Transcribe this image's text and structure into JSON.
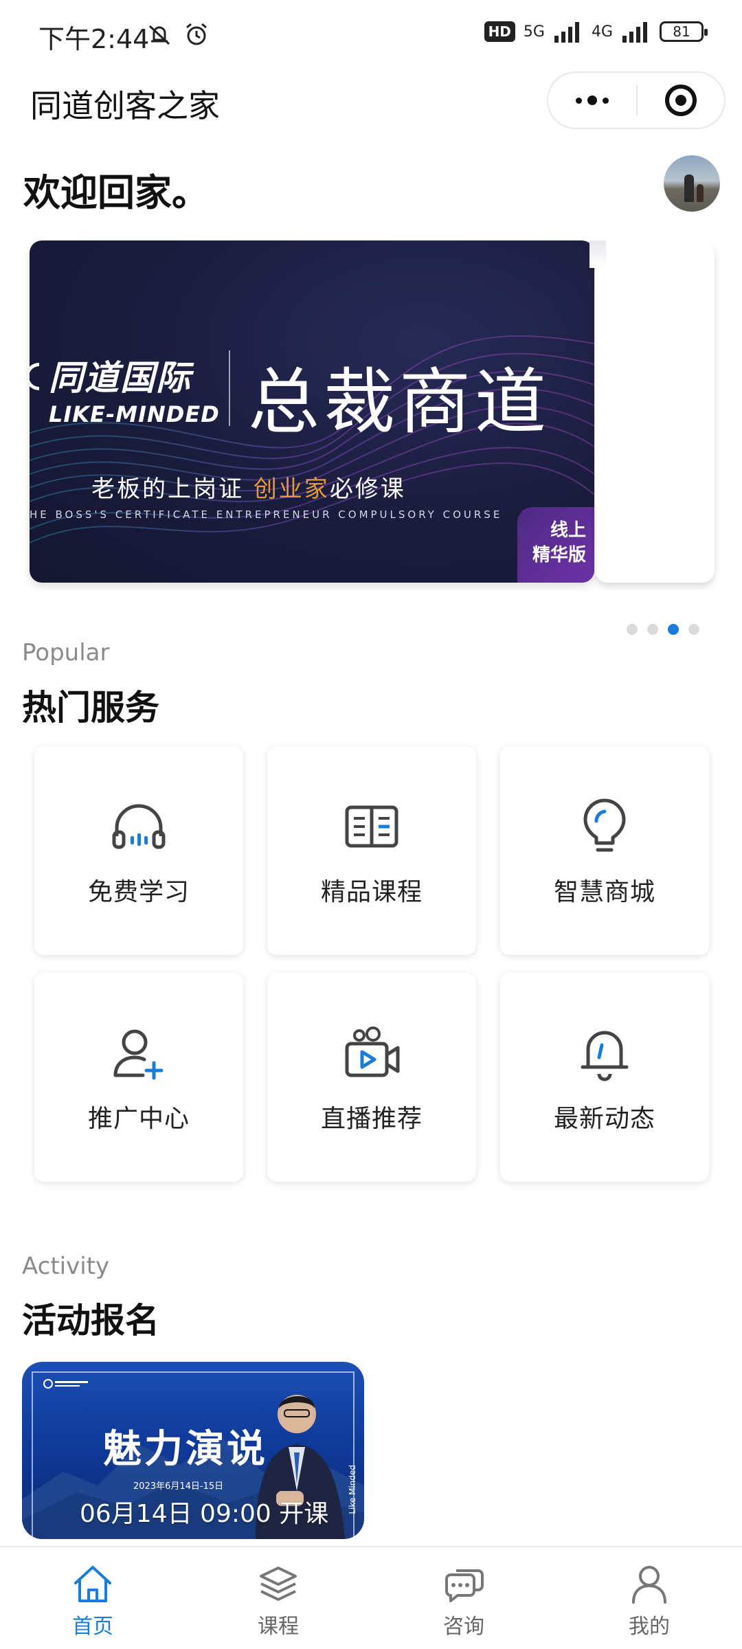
{
  "status_bar": {
    "time": "下午2:44",
    "hd": "HD",
    "net1": "5G",
    "net2": "4G",
    "battery": "81"
  },
  "header": {
    "title": "同道创客之家"
  },
  "welcome": "欢迎回家。",
  "banner": {
    "logo_zh": "同道国际",
    "logo_en": "LIKE-MINDED",
    "title": "总裁商道",
    "subtitle_pre": "老板的上岗证 ",
    "subtitle_highlight": "创业家",
    "subtitle_post": "必修课",
    "subtitle_en": "HE BOSS'S CERTIFICATE ENTREPRENEUR COMPULSORY COURSE",
    "tag_line1": "线上",
    "tag_line2": "精华版",
    "dots": 4,
    "active_dot": 2
  },
  "popular": {
    "en": "Popular",
    "zh": "热门服务",
    "items": [
      {
        "label": "免费学习",
        "icon": "headphones-icon"
      },
      {
        "label": "精品课程",
        "icon": "book-icon"
      },
      {
        "label": "智慧商城",
        "icon": "lightbulb-icon"
      },
      {
        "label": "推广中心",
        "icon": "user-plus-icon"
      },
      {
        "label": "直播推荐",
        "icon": "video-camera-icon"
      },
      {
        "label": "最新动态",
        "icon": "bell-icon"
      }
    ]
  },
  "activity": {
    "en": "Activity",
    "zh": "活动报名",
    "card": {
      "title": "魅力演说",
      "date": "2023年6月14日-15日",
      "time": "06月14日 09:00 开课",
      "side": "Like Minded"
    }
  },
  "tabbar": {
    "items": [
      {
        "label": "首页",
        "icon": "home-icon",
        "active": true
      },
      {
        "label": "课程",
        "icon": "layers-icon",
        "active": false
      },
      {
        "label": "咨询",
        "icon": "chat-icon",
        "active": false
      },
      {
        "label": "我的",
        "icon": "user-icon",
        "active": false
      }
    ]
  },
  "colors": {
    "accent": "#1a7cd8",
    "banner_bg": "#1a1c3c",
    "highlight": "#e59a3a"
  }
}
